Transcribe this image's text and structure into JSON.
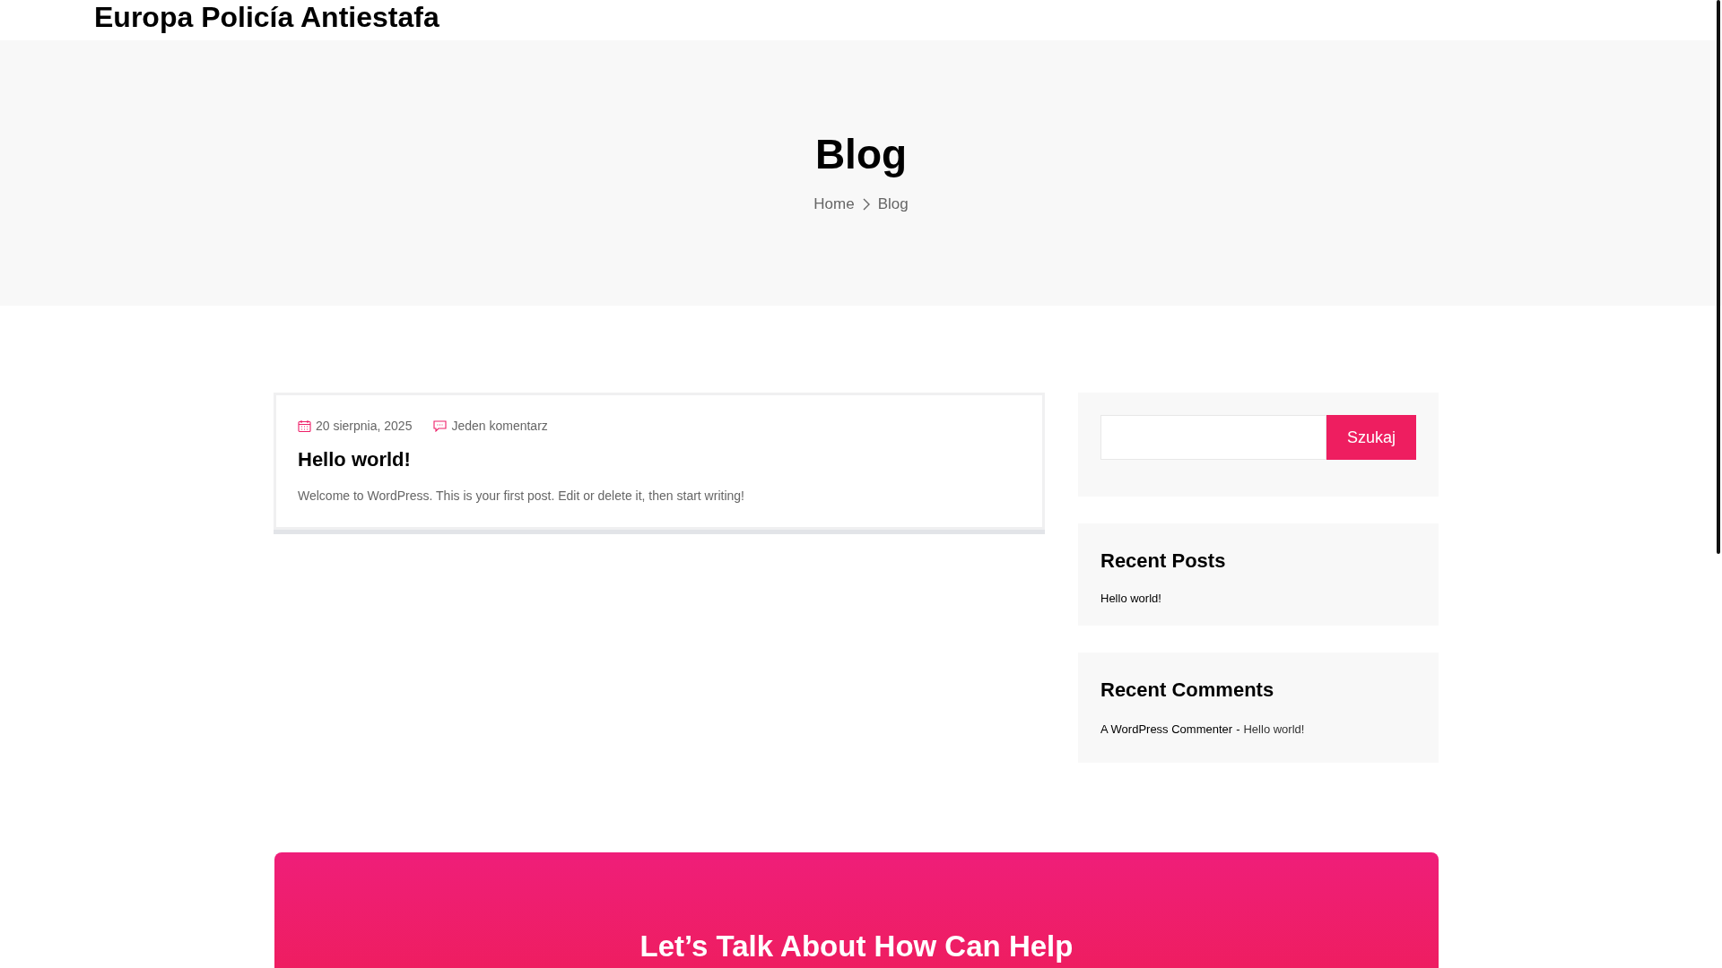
{
  "site_title": "Europa Policía Antiestafa",
  "hero": {
    "title": "Blog",
    "breadcrumb": [
      "Home",
      "Blog"
    ]
  },
  "post": {
    "date": "20 sierpnia, 2025",
    "comments": "Jeden komentarz",
    "title": "Hello world!",
    "excerpt": "Welcome to WordPress. This is your first post. Edit or delete it, then start writing!"
  },
  "search": {
    "button": "Szukaj"
  },
  "recent_posts": {
    "title": "Recent Posts",
    "items": [
      "Hello world!"
    ]
  },
  "recent_comments": {
    "title": "Recent Comments",
    "items": [
      {
        "author": "A WordPress Commenter",
        "separator": "-",
        "post": "Hello world!"
      }
    ]
  },
  "banner": {
    "title": "Let’s Talk About How Can Help"
  }
}
